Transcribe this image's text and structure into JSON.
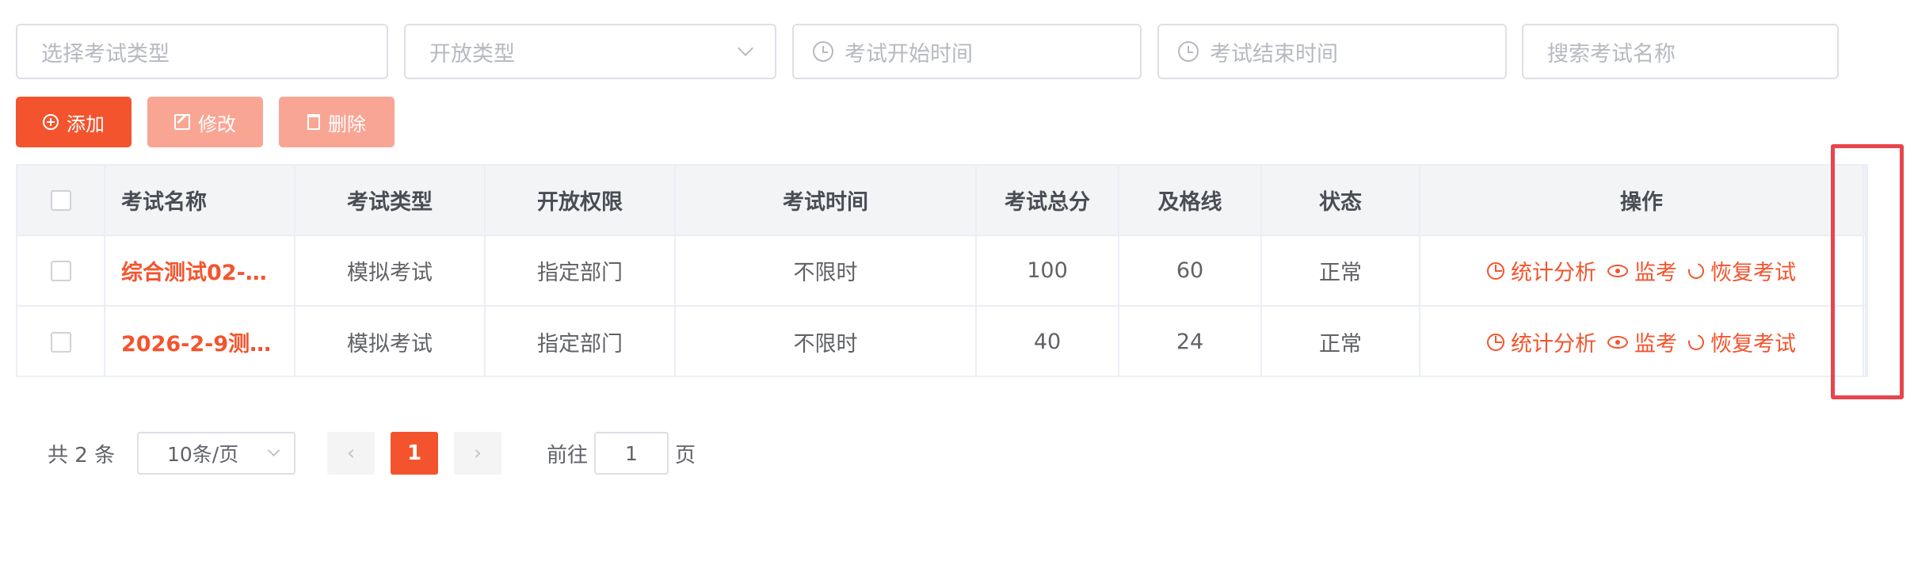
{
  "filters": {
    "exam_type_placeholder": "选择考试类型",
    "open_type_placeholder": "开放类型",
    "start_time_placeholder": "考试开始时间",
    "end_time_placeholder": "考试结束时间",
    "search_placeholder": "搜索考试名称"
  },
  "toolbar": {
    "add_label": "添加",
    "edit_label": "修改",
    "delete_label": "删除"
  },
  "table": {
    "headers": {
      "name": "考试名称",
      "type": "考试类型",
      "permission": "开放权限",
      "time": "考试时间",
      "total": "考试总分",
      "pass": "及格线",
      "status": "状态",
      "ops": "操作"
    },
    "rows": [
      {
        "name": "综合测试02-…",
        "type": "模拟考试",
        "permission": "指定部门",
        "time": "不限时",
        "total": "100",
        "pass": "60",
        "status": "正常"
      },
      {
        "name": "2026-2-9测…",
        "type": "模拟考试",
        "permission": "指定部门",
        "time": "不限时",
        "total": "40",
        "pass": "24",
        "status": "正常"
      }
    ],
    "ops": {
      "stats": "统计分析",
      "monitor": "监考",
      "restore": "恢复考试"
    }
  },
  "pagination": {
    "total_text": "共 2 条",
    "page_size": "10条/页",
    "prev": "‹",
    "current_page": "1",
    "next": "›",
    "goto_label": "前往",
    "goto_value": "1",
    "goto_suffix": "页"
  },
  "colors": {
    "accent": "#f4542d",
    "accent_disabled": "#f9a594",
    "highlight": "#e8454d"
  }
}
